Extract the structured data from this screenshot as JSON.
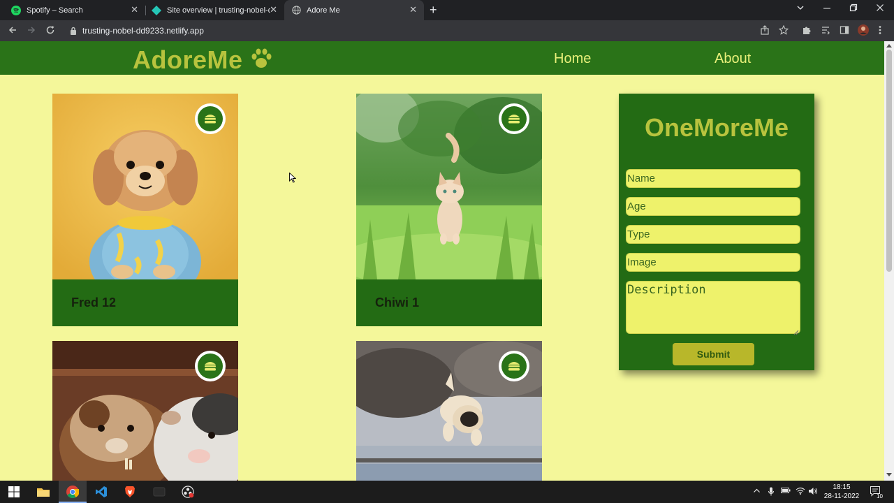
{
  "browser": {
    "tabs": [
      {
        "title": "Spotify – Search",
        "close": "✕"
      },
      {
        "title": "Site overview | trusting-nobel-dd",
        "close": "✕"
      },
      {
        "title": "Adore Me",
        "close": "✕"
      }
    ],
    "new_tab": "+",
    "url": "trusting-nobel-dd9233.netlify.app"
  },
  "site": {
    "brand": "AdoreMe",
    "nav": {
      "home": "Home",
      "about": "About"
    },
    "cards": [
      {
        "caption": "Fred 12"
      },
      {
        "caption": "Chiwi 1"
      },
      {
        "caption": ""
      },
      {
        "caption": ""
      }
    ],
    "form": {
      "title": "OneMoreMe",
      "name_placeholder": "Name",
      "age_placeholder": "Age",
      "type_placeholder": "Type",
      "image_placeholder": "Image",
      "description_placeholder": "Description",
      "submit_label": "Submit"
    }
  },
  "taskbar": {
    "time": "18:15",
    "date": "28-11-2022",
    "notification_count": "10"
  },
  "colors": {
    "page_bg": "#f4f79a",
    "nav_green": "#2a7318",
    "card_green": "#236b14",
    "brand_olive": "#b8c33e",
    "input_yellow": "#eef26b",
    "submit_olive": "#b8b72a"
  }
}
